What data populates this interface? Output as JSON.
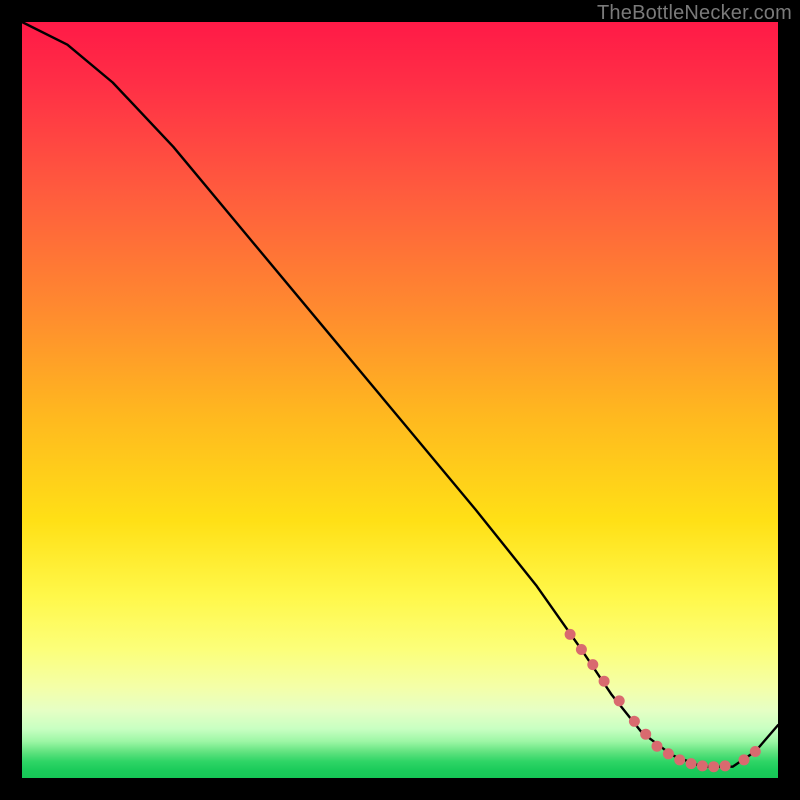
{
  "watermark": "TheBottleNecker.com",
  "chart_data": {
    "type": "line",
    "title": "",
    "xlabel": "",
    "ylabel": "",
    "xlim": [
      0,
      100
    ],
    "ylim": [
      0,
      100
    ],
    "series": [
      {
        "name": "curve",
        "x": [
          0,
          6,
          12,
          20,
          30,
          40,
          50,
          60,
          68,
          74,
          78,
          82,
          86,
          90,
          94,
          97,
          100
        ],
        "y": [
          100,
          97,
          92,
          83.5,
          71.5,
          59.5,
          47.5,
          35.5,
          25.5,
          17,
          11,
          6,
          3,
          1.5,
          1.5,
          3.5,
          7
        ]
      }
    ],
    "markers": {
      "name": "highlight",
      "x": [
        72.5,
        74,
        75.5,
        77,
        79,
        81,
        82.5,
        84,
        85.5,
        87,
        88.5,
        90,
        91.5,
        93,
        95.5,
        97
      ],
      "y": [
        19,
        17,
        15,
        12.8,
        10.2,
        7.5,
        5.8,
        4.2,
        3.2,
        2.4,
        1.9,
        1.6,
        1.5,
        1.6,
        2.4,
        3.5
      ]
    },
    "gradient_stops": [
      {
        "pos": 0.0,
        "color": "#ff1a47"
      },
      {
        "pos": 0.38,
        "color": "#ff8a2f"
      },
      {
        "pos": 0.66,
        "color": "#ffe016"
      },
      {
        "pos": 0.88,
        "color": "#f4ffa8"
      },
      {
        "pos": 1.0,
        "color": "#16c656"
      }
    ]
  }
}
